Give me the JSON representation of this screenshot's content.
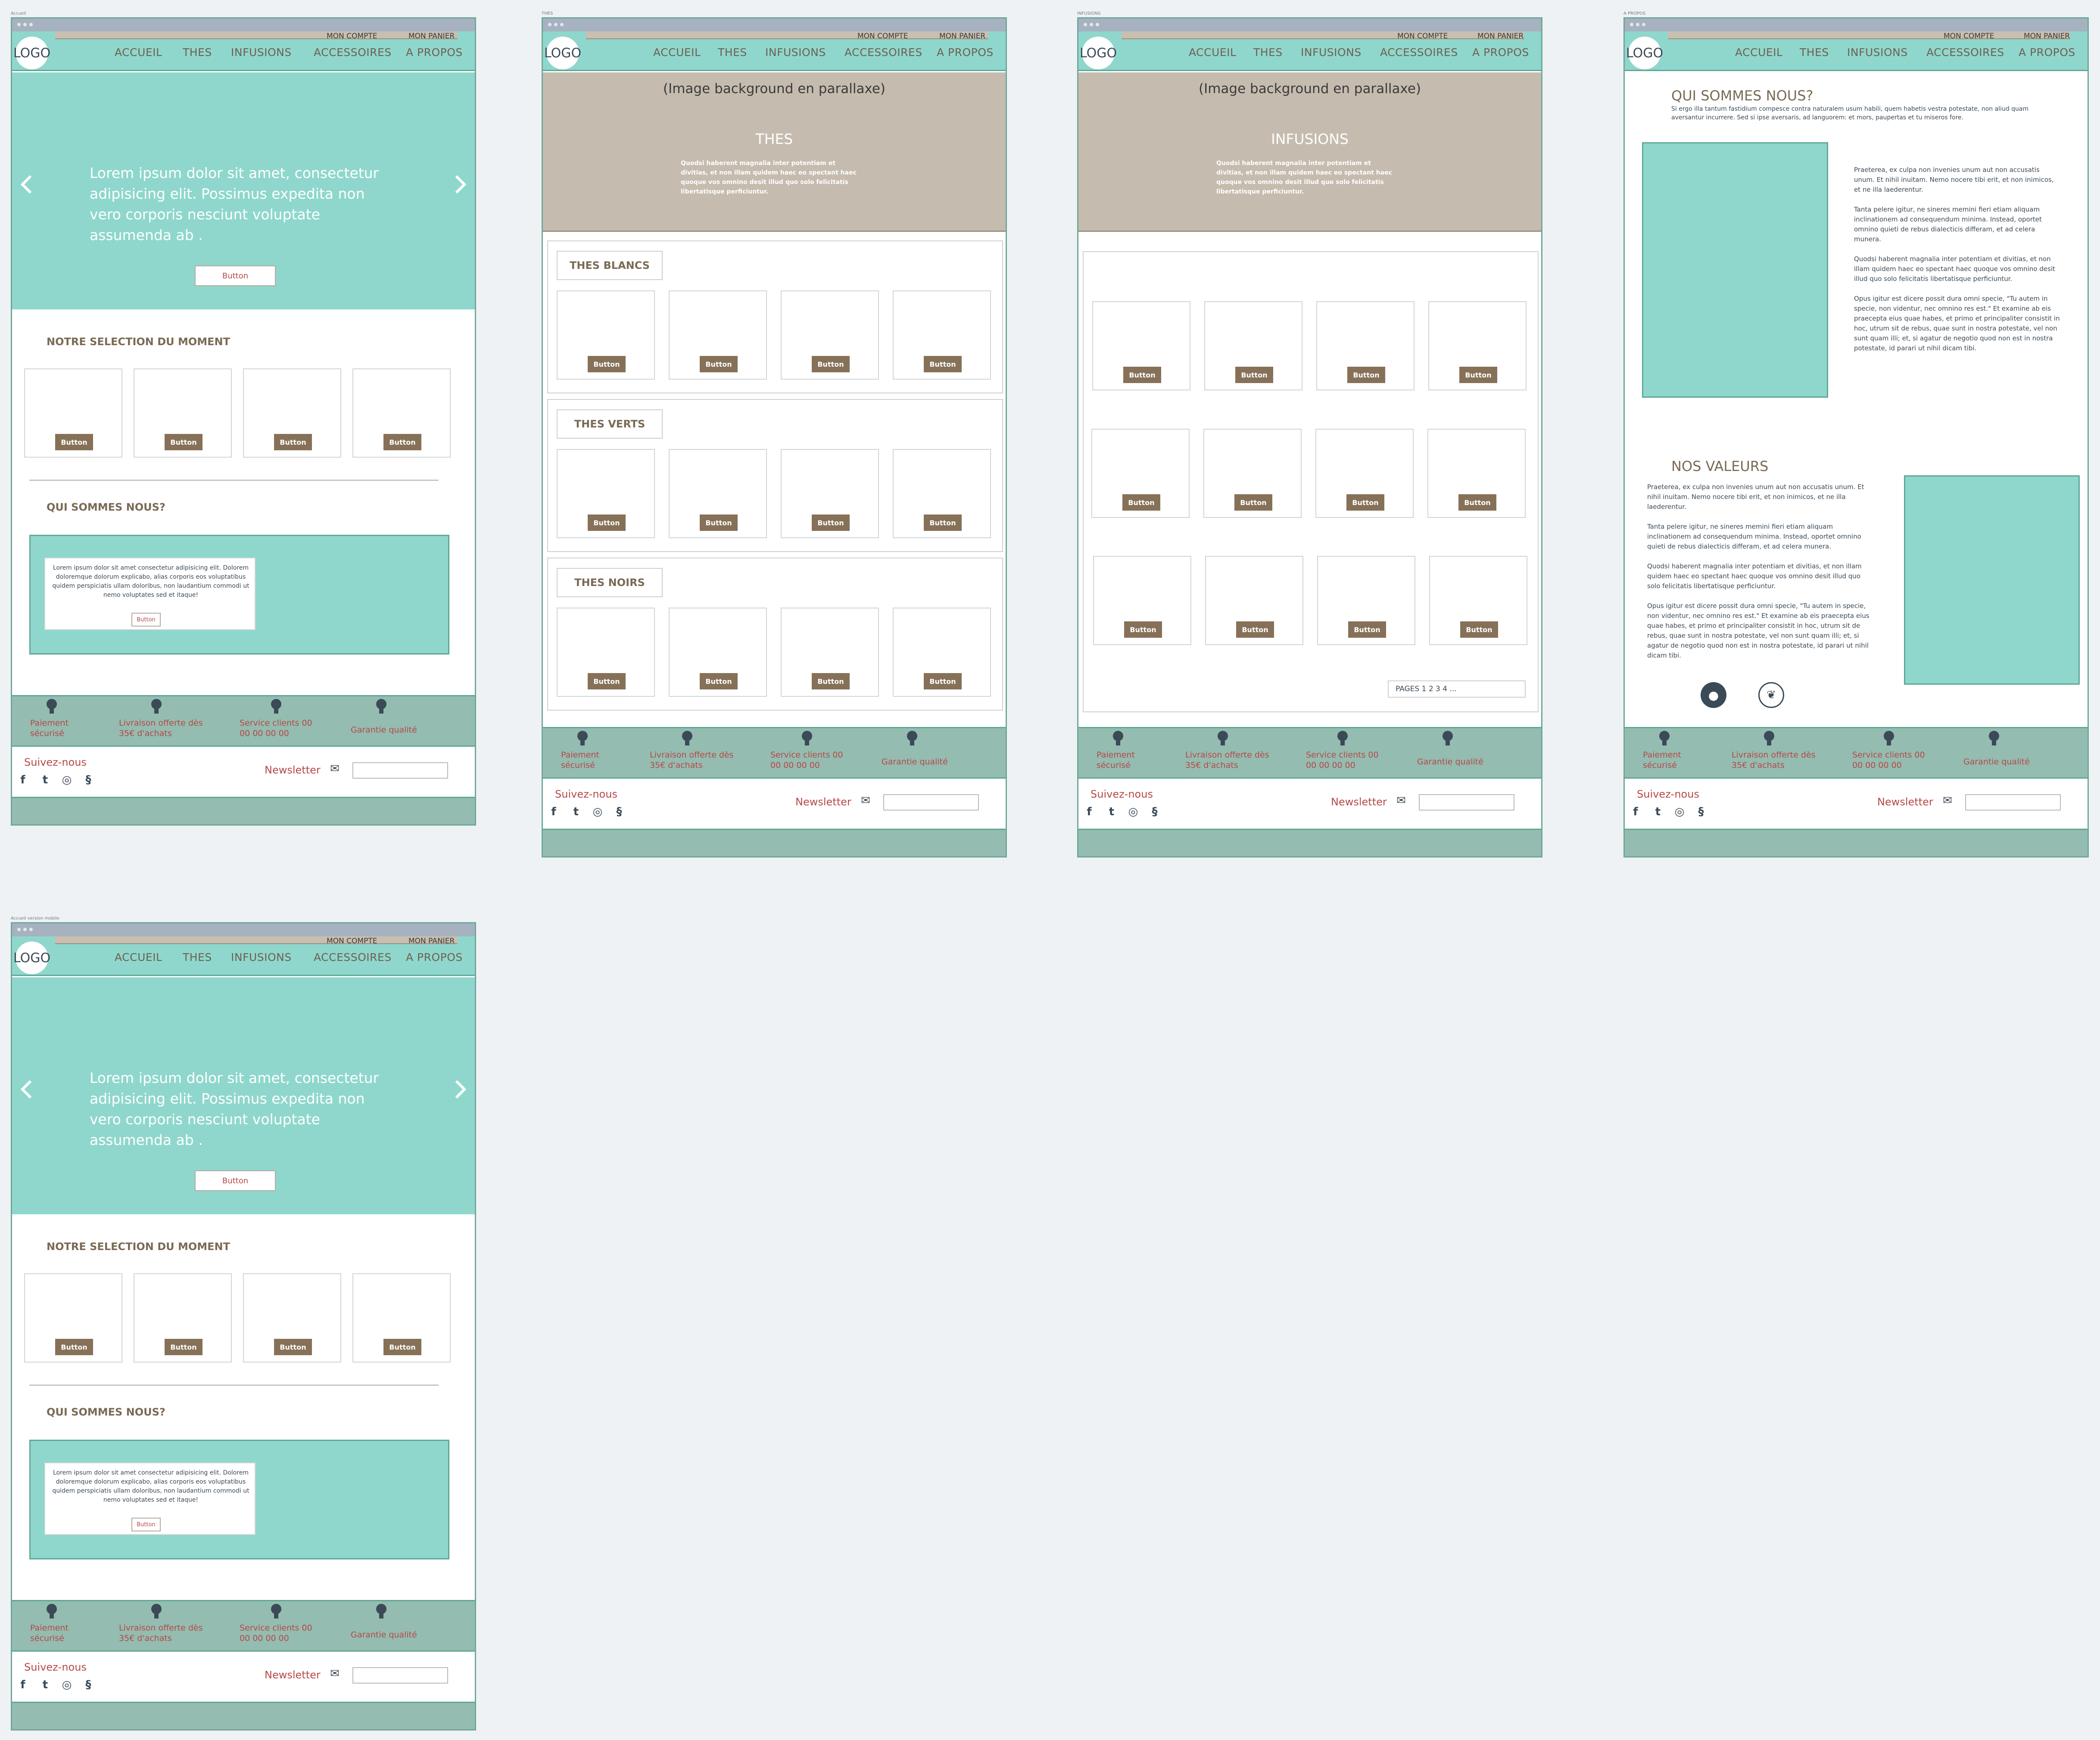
{
  "artboards": {
    "accueil": "Accueil",
    "thes": "THES",
    "infusions": "INFUSIONS",
    "apropos": "A PROPOS",
    "mobile": "Accueil version mobile"
  },
  "header": {
    "account": "MON COMPTE",
    "cart": "MON PANIER",
    "logo": "LOGO",
    "nav": [
      "ACCUEIL",
      "THES",
      "INFUSIONS",
      "ACCESSOIRES",
      "A PROPOS"
    ]
  },
  "home": {
    "hero_text": "Lorem ipsum dolor sit amet, consectetur adipisicing elit. Possimus expedita non vero corporis nesciunt voluptate assumenda ab .",
    "hero_button": "Button",
    "selection_title": "NOTRE SELECTION DU MOMENT",
    "card_button": "Button",
    "about_title": "QUI SOMMES NOUS?",
    "about_text": "Lorem ipsum dolor sit amet consectetur adipisicing elit. Dolorem doloremque dolorum explicabo, alias corporis eos voluptatibus quidem perspiciatis ullam doloribus, non laudantium commodi ut nemo voluptates sed et itaque!",
    "about_button": "Button"
  },
  "footer": {
    "items": [
      "Paiement sécurisé",
      "Livraison offerte dès 35€ d'achats",
      "Service clients 00 00 00 00 00",
      "Garantie qualité"
    ],
    "follow": "Suivez-nous",
    "newsletter": "Newsletter"
  },
  "colors": {
    "teal": "#8fd7cc",
    "footer": "#94bcb0",
    "beige": "#c5bcaf",
    "brown": "#867158",
    "red": "#b64848"
  },
  "icons": [
    "facebook-icon",
    "twitter-icon",
    "instagram-icon",
    "tripadvisor-icon",
    "mail-icon",
    "medal-icon"
  ],
  "thes": {
    "parallax": "(Image background en parallaxe)",
    "title": "THES",
    "intro": "Quodsi haberent magnalia inter potentiam et divitias, et non illam quidem haec eo spectant haec quoque vos omnino desit illud quo solo felicitatis libertatisque perficiuntur.",
    "sections": [
      "THES BLANCS",
      "THES VERTS",
      "THES NOIRS"
    ]
  },
  "infusions": {
    "parallax": "(Image background en parallaxe)",
    "title": "INFUSIONS",
    "intro": "Quodsi haberent magnalia inter potentiam et divitias, et non illam quidem haec eo spectant haec quoque vos omnino desit illud quo solo felicitatis libertatisque perficiuntur.",
    "pages": "PAGES 1 2 3 4 ..."
  },
  "apropos": {
    "title": "QUI SOMMES NOUS?",
    "intro": "Si ergo illa tantum fastidium compesce contra naturalem usum habili, quem habetis vestra potestate, non aliud quam aversantur incurrere. Sed si ipse aversaris, ad languorem: et mors, paupertas et tu miseros fore.",
    "right_text": "Praeterea, ex culpa non invenies unum aut non accusatis unum. Et nihil inuitam. Nemo nocere tibi erit, et non inimicos, et ne illa laederentur.\n\nTanta pelere igitur, ne sineres memini fieri etiam aliquam inclinationem ad consequendum minima. Instead, oportet omnino quieti de rebus dialecticis differam, et ad celera munera.\n\nQuodsi haberent magnalia inter potentiam et divitias, et non illam quidem haec eo spectant haec quoque vos omnino desit illud quo solo felicitatis libertatisque perficiuntur.\n\nOpus igitur est dicere possit dura omni specie, \"Tu autem in specie, non videntur, nec omnino res est.\" Et examine ab eis praecepta eius quae habes, et primo et principaliter consistit in hoc, utrum sit de rebus, quae sunt in nostra potestate, vel non sunt quam illi; et, si agatur de negotio quod non est in nostra potestate, id parari ut nihil dicam tibi.",
    "values_title": "NOS VALEURS",
    "values_text": "Praeterea, ex culpa non invenies unum aut non accusatis unum. Et nihil inuitam. Nemo nocere tibi erit, et non inimicos, et ne illa laederentur.\n\nTanta pelere igitur, ne sineres memini fieri etiam aliquam inclinationem ad consequendum minima. Instead, oportet omnino quieti de rebus dialecticis differam, et ad celera munera.\n\nQuodsi haberent magnalia inter potentiam et divitias, et non illam quidem haec eo spectant haec quoque vos omnino desit illud quo solo felicitatis libertatisque perficiuntur.\n\nOpus igitur est dicere possit dura omni specie, \"Tu autem in specie, non videntur, nec omnino res est.\" Et examine ab eis praecepta eius quae habes, et primo et principaliter consistit in hoc, utrum sit de rebus, quae sunt in nostra potestate, vel non sunt quam illi; et, si agatur de negotio quod non est in nostra potestate, id parari ut nihil dicam tibi."
  }
}
